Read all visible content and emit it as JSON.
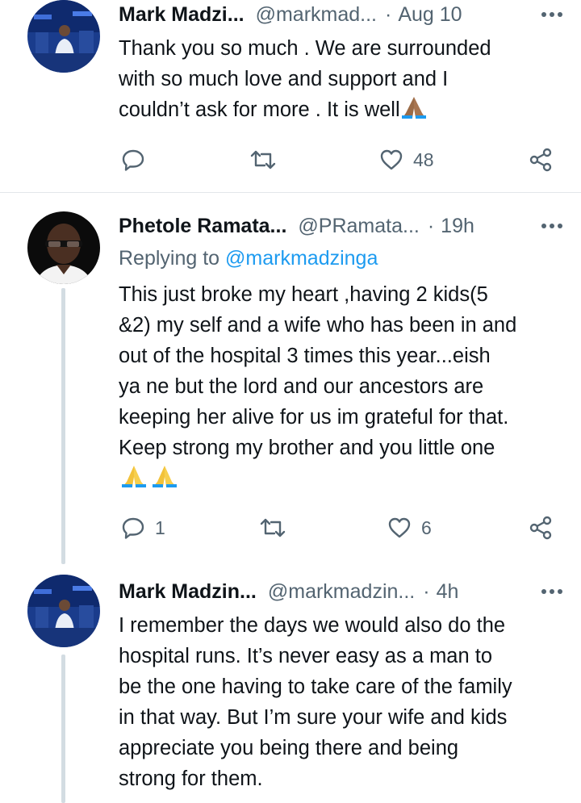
{
  "tweets": [
    {
      "name": "Mark Madzi...",
      "handle": "@markmad...",
      "separator": "·",
      "time": "Aug 10",
      "lines": [
        "Thank you so much . We are surrounded",
        "with so much love and support and  I",
        "couldn’t ask for more . It is well"
      ],
      "emoji": "folded-hands-dark",
      "actions": {
        "reply_count": "",
        "retweet_count": "",
        "like_count": "48"
      }
    },
    {
      "name": "Phetole Ramata...",
      "handle": "@PRamata...",
      "separator": "·",
      "time": "19h",
      "replying_prefix": "Replying to",
      "replying_to": "@markmadzinga",
      "lines": [
        "This just broke my heart ,having 2 kids(5",
        "&2) my self and a wife who has been in and",
        "out of the hospital 3 times this year...eish",
        "ya ne but the lord and our ancestors are",
        "keeping her alive for us im grateful for that.",
        "Keep strong my brother and you little one"
      ],
      "emoji": "folded-hands-yellow-x2",
      "actions": {
        "reply_count": "1",
        "retweet_count": "",
        "like_count": "6"
      }
    },
    {
      "name": "Mark Madzin...",
      "handle": "@markmadzin...",
      "separator": "·",
      "time": "4h",
      "lines": [
        "I remember the days we would also do the",
        "hospital runs. It’s never easy as a man to",
        "be the one having to take care of the family",
        "in that way. But I’m sure your wife and kids",
        "appreciate you being there and being",
        "strong for them."
      ]
    }
  ],
  "colors": {
    "text": "#0f1419",
    "secondary": "#536471",
    "link": "#1d9bf0",
    "divider": "#e3e7ea",
    "thread_line": "#d3dce2"
  },
  "icons": {
    "reply": "reply-icon",
    "retweet": "retweet-icon",
    "like": "heart-icon",
    "share": "share-icon",
    "more": "more-icon"
  }
}
